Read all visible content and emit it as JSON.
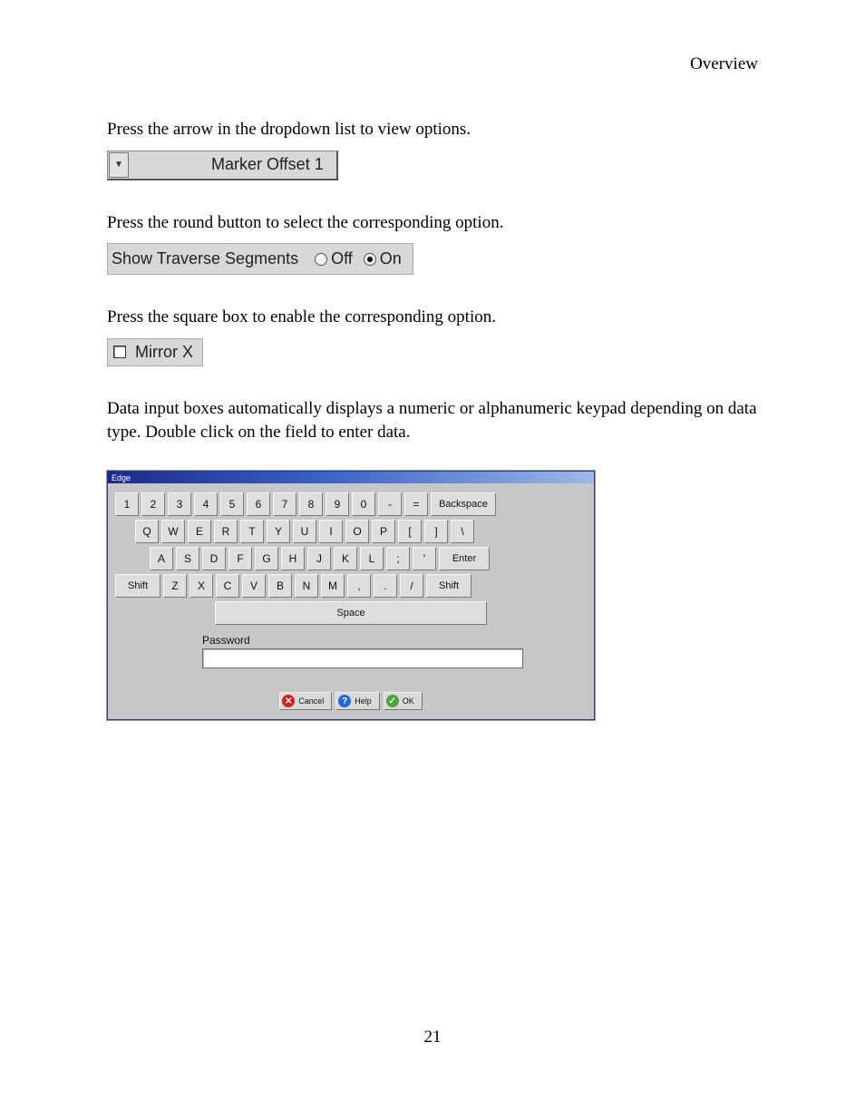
{
  "header": {
    "title": "Overview"
  },
  "para1": "Press the arrow in the dropdown list to view options.",
  "dropdown": {
    "label": "Marker Offset 1"
  },
  "para2": "Press the round button to select the corresponding option.",
  "radio": {
    "label": "Show Traverse Segments",
    "off": "Off",
    "on": "On",
    "selected": "On"
  },
  "para3": "Press the square box to enable the corresponding option.",
  "checkbox": {
    "label": "Mirror X",
    "checked": false
  },
  "para4": "Data input boxes automatically displays a numeric or alphanumeric keypad depending on data type.  Double click on the field to enter data.",
  "keyboard": {
    "title": "Edge",
    "rows": {
      "r1": [
        "1",
        "2",
        "3",
        "4",
        "5",
        "6",
        "7",
        "8",
        "9",
        "0",
        "-",
        "=",
        "Backspace"
      ],
      "r2": [
        "Q",
        "W",
        "E",
        "R",
        "T",
        "Y",
        "U",
        "I",
        "O",
        "P",
        "[",
        "]",
        "\\"
      ],
      "r3": [
        "A",
        "S",
        "D",
        "F",
        "G",
        "H",
        "J",
        "K",
        "L",
        ";",
        "'",
        "Enter"
      ],
      "r4": [
        "Shift",
        "Z",
        "X",
        "C",
        "V",
        "B",
        "N",
        "M",
        ",",
        ".",
        "/",
        "Shift"
      ],
      "space": "Space"
    },
    "password_label": "Password",
    "buttons": {
      "cancel": "Cancel",
      "help": "Help",
      "ok": "OK"
    }
  },
  "page_number": "21"
}
